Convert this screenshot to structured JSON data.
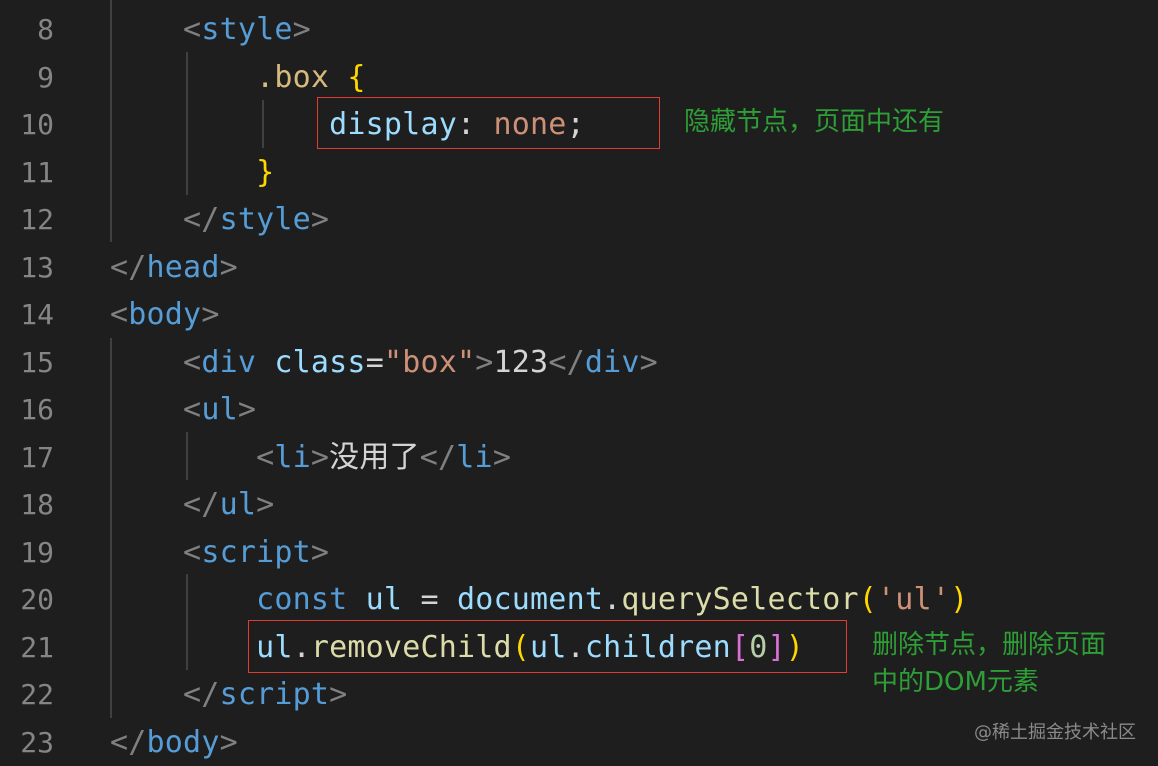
{
  "editor": {
    "lines": [
      {
        "num": "8",
        "tokens": [
          [
            "    ",
            "txt"
          ],
          [
            "<",
            "br"
          ],
          [
            "style",
            "tag"
          ],
          [
            ">",
            "br"
          ]
        ]
      },
      {
        "num": "9",
        "tokens": [
          [
            "        ",
            "txt"
          ],
          [
            ".box",
            "sel"
          ],
          [
            " ",
            "txt"
          ],
          [
            "{",
            "p1"
          ]
        ]
      },
      {
        "num": "10",
        "tokens": [
          [
            "            ",
            "txt"
          ],
          [
            "display",
            "prop"
          ],
          [
            ": ",
            "txt"
          ],
          [
            "none",
            "val"
          ],
          [
            ";",
            "txt"
          ]
        ]
      },
      {
        "num": "11",
        "tokens": [
          [
            "        ",
            "txt"
          ],
          [
            "}",
            "p1"
          ]
        ]
      },
      {
        "num": "12",
        "tokens": [
          [
            "    ",
            "txt"
          ],
          [
            "</",
            "br"
          ],
          [
            "style",
            "tag"
          ],
          [
            ">",
            "br"
          ]
        ]
      },
      {
        "num": "13",
        "tokens": [
          [
            "</",
            "br"
          ],
          [
            "head",
            "tag"
          ],
          [
            ">",
            "br"
          ]
        ]
      },
      {
        "num": "14",
        "tokens": [
          [
            "<",
            "br"
          ],
          [
            "body",
            "tag"
          ],
          [
            ">",
            "br"
          ]
        ]
      },
      {
        "num": "15",
        "tokens": [
          [
            "    ",
            "txt"
          ],
          [
            "<",
            "br"
          ],
          [
            "div",
            "tag"
          ],
          [
            " ",
            "txt"
          ],
          [
            "class",
            "attr"
          ],
          [
            "=",
            "txt"
          ],
          [
            "\"box\"",
            "str"
          ],
          [
            ">",
            "br"
          ],
          [
            "123",
            "txt"
          ],
          [
            "</",
            "br"
          ],
          [
            "div",
            "tag"
          ],
          [
            ">",
            "br"
          ]
        ]
      },
      {
        "num": "16",
        "tokens": [
          [
            "    ",
            "txt"
          ],
          [
            "<",
            "br"
          ],
          [
            "ul",
            "tag"
          ],
          [
            ">",
            "br"
          ]
        ]
      },
      {
        "num": "17",
        "tokens": [
          [
            "        ",
            "txt"
          ],
          [
            "<",
            "br"
          ],
          [
            "li",
            "tag"
          ],
          [
            ">",
            "br"
          ],
          [
            "没用了",
            "txt"
          ],
          [
            "</",
            "br"
          ],
          [
            "li",
            "tag"
          ],
          [
            ">",
            "br"
          ]
        ]
      },
      {
        "num": "18",
        "tokens": [
          [
            "    ",
            "txt"
          ],
          [
            "</",
            "br"
          ],
          [
            "ul",
            "tag"
          ],
          [
            ">",
            "br"
          ]
        ]
      },
      {
        "num": "19",
        "tokens": [
          [
            "    ",
            "txt"
          ],
          [
            "<",
            "br"
          ],
          [
            "script",
            "tag"
          ],
          [
            ">",
            "br"
          ]
        ]
      },
      {
        "num": "20",
        "tokens": [
          [
            "        ",
            "txt"
          ],
          [
            "const",
            "kw"
          ],
          [
            " ",
            "txt"
          ],
          [
            "ul",
            "var"
          ],
          [
            " = ",
            "txt"
          ],
          [
            "document",
            "var"
          ],
          [
            ".",
            "txt"
          ],
          [
            "querySelector",
            "fn"
          ],
          [
            "(",
            "p1"
          ],
          [
            "'ul'",
            "str"
          ],
          [
            ")",
            "p1"
          ]
        ]
      },
      {
        "num": "21",
        "tokens": [
          [
            "        ",
            "txt"
          ],
          [
            "ul",
            "var"
          ],
          [
            ".",
            "txt"
          ],
          [
            "removeChild",
            "fn"
          ],
          [
            "(",
            "p1"
          ],
          [
            "ul",
            "var"
          ],
          [
            ".",
            "txt"
          ],
          [
            "children",
            "var"
          ],
          [
            "[",
            "p2"
          ],
          [
            "0",
            "num"
          ],
          [
            "]",
            "p2"
          ],
          [
            ")",
            "p1"
          ]
        ]
      },
      {
        "num": "22",
        "tokens": [
          [
            "    ",
            "txt"
          ],
          [
            "</",
            "br"
          ],
          [
            "script",
            "tag"
          ],
          [
            ">",
            "br"
          ]
        ]
      },
      {
        "num": "23",
        "tokens": [
          [
            "</",
            "br"
          ],
          [
            "body",
            "tag"
          ],
          [
            ">",
            "br"
          ]
        ]
      }
    ]
  },
  "annotations": {
    "hide_note": "隐藏节点，页面中还有",
    "remove_note_line1": "删除节点，删除页面",
    "remove_note_line2": "中的DOM元素"
  },
  "watermark": "@稀土掘金技术社区"
}
